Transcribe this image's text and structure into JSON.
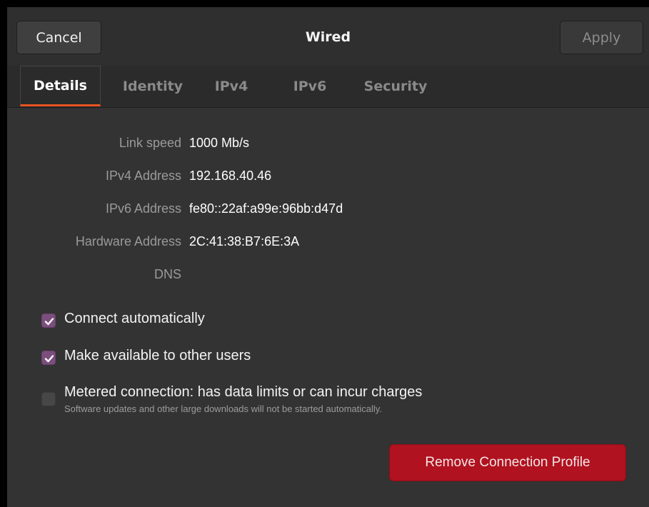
{
  "header": {
    "cancel_label": "Cancel",
    "title": "Wired",
    "apply_label": "Apply"
  },
  "tabs": [
    {
      "label": "Details",
      "active": true
    },
    {
      "label": "Identity",
      "active": false
    },
    {
      "label": "IPv4",
      "active": false
    },
    {
      "label": "IPv6",
      "active": false
    },
    {
      "label": "Security",
      "active": false
    }
  ],
  "details": {
    "link_speed_label": "Link speed",
    "link_speed_value": "1000 Mb/s",
    "ipv4_label": "IPv4 Address",
    "ipv4_value": "192.168.40.46",
    "ipv6_label": "IPv6 Address",
    "ipv6_value": "fe80::22af:a99e:96bb:d47d",
    "hw_label": "Hardware Address",
    "hw_value": "2C:41:38:B7:6E:3A",
    "dns_label": "DNS"
  },
  "options": {
    "connect_auto_label": "Connect automatically",
    "connect_auto_checked": true,
    "share_label": "Make available to other users",
    "share_checked": true,
    "metered_label": "Metered connection: has data limits or can incur charges",
    "metered_sub": "Software updates and other large downloads will not be started automatically.",
    "metered_checked": false
  },
  "remove_label": "Remove Connection Profile",
  "colors": {
    "accent_tab": "#e95420",
    "check": "#7b4e7e",
    "destructive": "#b0121f"
  },
  "icons": {
    "check": "checkmark-icon"
  }
}
